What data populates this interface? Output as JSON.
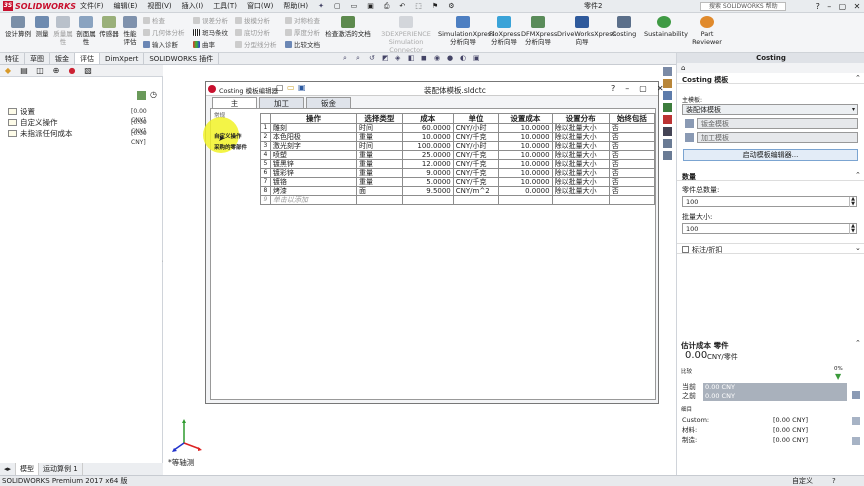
{
  "app": {
    "brand": "SOLIDWORKS",
    "doc_title": "零件2",
    "search_placeholder": "搜索 SOLIDWORKS 帮助",
    "status": "SOLIDWORKS Premium 2017 x64 版",
    "units": "自定义"
  },
  "menu": [
    "文件(F)",
    "编辑(E)",
    "视图(V)",
    "插入(I)",
    "工具(T)",
    "窗口(W)",
    "帮助(H)"
  ],
  "ribbon": {
    "big_left": [
      {
        "label": "设计算例"
      },
      {
        "label": "测量"
      },
      {
        "label": "质量属性"
      },
      {
        "label": "剖面属性"
      },
      {
        "label": "传感器"
      },
      {
        "label": "性能评估"
      }
    ],
    "small_col1": [
      {
        "label": "检查",
        "dis": true
      },
      {
        "label": "几何体分析",
        "dis": true
      },
      {
        "label": "输入诊断",
        "dis": false
      }
    ],
    "small_col2": [
      {
        "label": "误差分析",
        "dis": true
      },
      {
        "label": "斑马条纹",
        "dis": false
      },
      {
        "label": "曲率",
        "dis": false
      }
    ],
    "small_col3": [
      {
        "label": "拔模分析",
        "dis": true
      },
      {
        "label": "底切分析",
        "dis": true
      },
      {
        "label": "分型线分析",
        "dis": true
      }
    ],
    "small_col4": [
      {
        "label": "对称检查",
        "dis": true
      },
      {
        "label": "厚度分析",
        "dis": true
      },
      {
        "label": "比较文档",
        "dis": false
      }
    ],
    "check_active": "检查激活的文档",
    "big_right": [
      {
        "label": "3DEXPERIENCE Simulation Connector",
        "dis": true
      },
      {
        "label": "SimulationXpress 分析向导"
      },
      {
        "label": "FloXpress 分析向导"
      },
      {
        "label": "DFMXpress 分析向导"
      },
      {
        "label": "DriveWorksXpress 向导"
      },
      {
        "label": "Costing"
      },
      {
        "label": "Sustainability"
      },
      {
        "label": "Part Reviewer"
      }
    ]
  },
  "cmd_tabs": [
    "特征",
    "草图",
    "钣金",
    "评估",
    "DimXpert",
    "SOLIDWORKS 插件"
  ],
  "cmd_tab_selected": 3,
  "tree": [
    {
      "label": "设置",
      "cost": "[0.00 CNY]"
    },
    {
      "label": "自定义操作",
      "cost": "[0.00 CNY]"
    },
    {
      "label": "未指派任何成本",
      "cost": "[0.00 CNY]"
    }
  ],
  "view_label": "*等轴测",
  "bottom_tabs": [
    "模型",
    "运动算例 1"
  ],
  "dialog": {
    "name": "Costing 模板编辑器",
    "file": "装配体模板.sldctc",
    "tabs": [
      "主",
      "加工",
      "钣金"
    ],
    "nav": [
      "常规",
      "自定义操作",
      "采购的零部件"
    ],
    "columns": [
      "操作",
      "选择类型",
      "成本",
      "单位",
      "设置成本",
      "设置分布",
      "始终包括"
    ],
    "rows": [
      {
        "n": "1",
        "op": "雕刻",
        "type": "时间",
        "cost": "60.0000",
        "unit": "CNY/小时",
        "setup": "10.0000",
        "dist": "除以批量大小",
        "always": "否"
      },
      {
        "n": "2",
        "op": "本色阳极",
        "type": "重量",
        "cost": "10.0000",
        "unit": "CNY/千克",
        "setup": "10.0000",
        "dist": "除以批量大小",
        "always": "否"
      },
      {
        "n": "3",
        "op": "激光刻字",
        "type": "时间",
        "cost": "100.0000",
        "unit": "CNY/小时",
        "setup": "10.0000",
        "dist": "除以批量大小",
        "always": "否"
      },
      {
        "n": "4",
        "op": "喷塑",
        "type": "重量",
        "cost": "25.0000",
        "unit": "CNY/千克",
        "setup": "10.0000",
        "dist": "除以批量大小",
        "always": "否"
      },
      {
        "n": "5",
        "op": "镀黑锌",
        "type": "重量",
        "cost": "12.0000",
        "unit": "CNY/千克",
        "setup": "10.0000",
        "dist": "除以批量大小",
        "always": "否"
      },
      {
        "n": "6",
        "op": "镀彩锌",
        "type": "重量",
        "cost": "9.0000",
        "unit": "CNY/千克",
        "setup": "10.0000",
        "dist": "除以批量大小",
        "always": "否"
      },
      {
        "n": "7",
        "op": "镀铬",
        "type": "重量",
        "cost": "5.0000",
        "unit": "CNY/千克",
        "setup": "10.0000",
        "dist": "除以批量大小",
        "always": "否"
      },
      {
        "n": "8",
        "op": "烤漆",
        "type": "面",
        "cost": "9.5000",
        "unit": "CNY/m^2",
        "setup": "0.0000",
        "dist": "除以批量大小",
        "always": "否"
      }
    ],
    "add_row": {
      "n": "9",
      "label": "单击以添加"
    }
  },
  "costing": {
    "title": "Costing",
    "template_section": "Costing 模板",
    "main_template_label": "主模板:",
    "main_template_value": "装配体模板",
    "sheet_metal": "钣金模板",
    "machining": "加工模板",
    "launch_btn": "启动模板编辑器...",
    "quantity_section": "数量",
    "total_parts_label": "零件总数量:",
    "total_parts": "100",
    "batch_label": "批量大小:",
    "batch": "100",
    "markup": "标注/折扣",
    "estimate_title": "估计成本 零件",
    "estimate_value": "0.00",
    "estimate_unit": "CNY/零件",
    "compare": "比较",
    "pct": "0%",
    "current_label": "当前",
    "prev_label": "之前",
    "current_val": "0.00 CNY",
    "prev_val": "0.00 CNY",
    "breakdown": "细目",
    "custom_label": "Custom:",
    "custom_val": "[0.00 CNY]",
    "material_label": "材料:",
    "material_val": "[0.00 CNY]",
    "mfg_label": "制造:",
    "mfg_val": "[0.00 CNY]"
  },
  "colors": {
    "accent": "#c8102e",
    "highlight": "#f1f227",
    "button_border": "#7ba4d1"
  }
}
